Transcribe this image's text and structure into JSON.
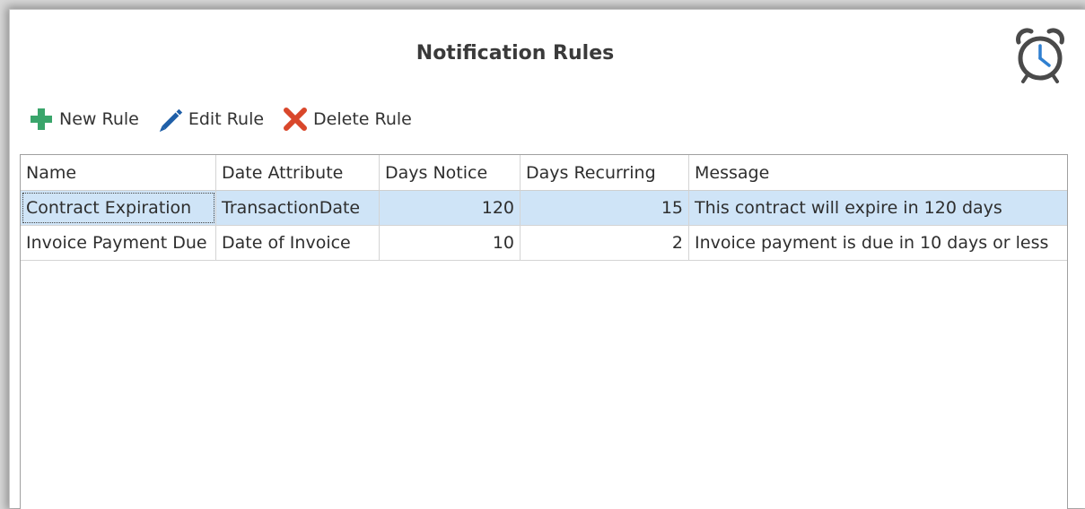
{
  "panel": {
    "title": "Notification Rules",
    "icon": "alarm-clock-icon"
  },
  "toolbar": {
    "new_rule": {
      "label": "New Rule",
      "icon": "plus-icon",
      "color": "#3aa56b"
    },
    "edit_rule": {
      "label": "Edit Rule",
      "icon": "pencil-icon",
      "color": "#1f5fa8"
    },
    "delete_rule": {
      "label": "Delete Rule",
      "icon": "x-icon",
      "color": "#d9472b"
    }
  },
  "table": {
    "columns": [
      "Name",
      "Date Attribute",
      "Days Notice",
      "Days Recurring",
      "Message"
    ],
    "rows": [
      {
        "name": "Contract Expiration",
        "date_attribute": "TransactionDate",
        "days_notice": "120",
        "days_recurring": "15",
        "message": "This contract will expire in 120 days",
        "selected": true
      },
      {
        "name": "Invoice Payment Due",
        "date_attribute": "Date of Invoice",
        "days_notice": "10",
        "days_recurring": "2",
        "message": "Invoice payment is due in 10 days or less",
        "selected": false
      }
    ]
  },
  "colors": {
    "selection": "#cfe4f7",
    "clock": "#4a4a4a",
    "clock_accent": "#2f7fd0"
  }
}
